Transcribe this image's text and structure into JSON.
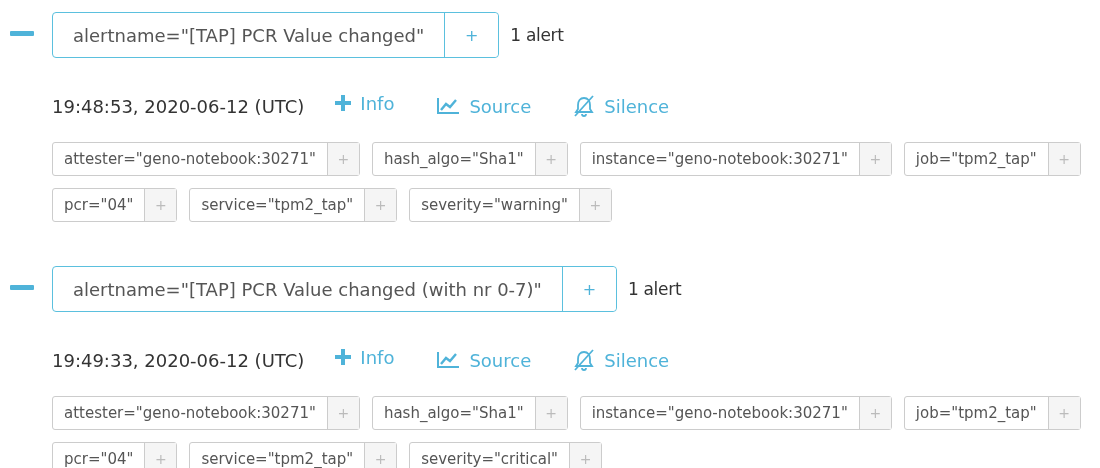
{
  "groups": [
    {
      "expanded": true,
      "matcher": "alertname=\"[TAP] PCR Value changed\"",
      "add_button": "+",
      "count": "1 alert",
      "alerts": [
        {
          "time": "19:48:53, 2020-06-12 (UTC)",
          "actions": [
            {
              "kind": "info",
              "label": "Info"
            },
            {
              "kind": "source",
              "label": "Source"
            },
            {
              "kind": "silence",
              "label": "Silence"
            }
          ],
          "labels": [
            {
              "text": "attester=\"geno-notebook:30271\"",
              "add": "+"
            },
            {
              "text": "hash_algo=\"Sha1\"",
              "add": "+"
            },
            {
              "text": "instance=\"geno-notebook:30271\"",
              "add": "+"
            },
            {
              "text": "job=\"tpm2_tap\"",
              "add": "+"
            },
            {
              "text": "pcr=\"04\"",
              "add": "+"
            },
            {
              "text": "service=\"tpm2_tap\"",
              "add": "+"
            },
            {
              "text": "severity=\"warning\"",
              "add": "+"
            }
          ]
        }
      ]
    },
    {
      "expanded": true,
      "matcher": "alertname=\"[TAP] PCR Value changed (with nr 0-7)\"",
      "add_button": "+",
      "count": "1 alert",
      "alerts": [
        {
          "time": "19:49:33, 2020-06-12 (UTC)",
          "actions": [
            {
              "kind": "info",
              "label": "Info"
            },
            {
              "kind": "source",
              "label": "Source"
            },
            {
              "kind": "silence",
              "label": "Silence"
            }
          ],
          "labels": [
            {
              "text": "attester=\"geno-notebook:30271\"",
              "add": "+"
            },
            {
              "text": "hash_algo=\"Sha1\"",
              "add": "+"
            },
            {
              "text": "instance=\"geno-notebook:30271\"",
              "add": "+"
            },
            {
              "text": "job=\"tpm2_tap\"",
              "add": "+"
            },
            {
              "text": "pcr=\"04\"",
              "add": "+"
            },
            {
              "text": "service=\"tpm2_tap\"",
              "add": "+"
            },
            {
              "text": "severity=\"critical\"",
              "add": "+"
            }
          ]
        }
      ]
    }
  ]
}
